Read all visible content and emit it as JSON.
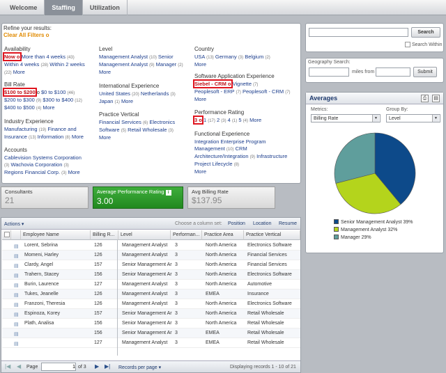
{
  "tabs": [
    "Welcome",
    "Staffing",
    "Utilization"
  ],
  "refine": {
    "title": "Refine your results:",
    "clear": "Clear All Filters",
    "clear_icon": "o"
  },
  "availability": {
    "title": "Availability",
    "now": "Now o",
    "line1": "More than 4 weeks",
    "c1": "(43)",
    "line2": "Within 4 weeks",
    "c2": "(28)",
    "line3": "Within 2 weeks",
    "c3": "(22)",
    "more": "More"
  },
  "billrate": {
    "title": "Bill Rate",
    "sel": "$100 to $200",
    "x": "o",
    "r1": "$0 to $100",
    "c1": "(46)",
    "r2": "$200 to $300",
    "c2": "(9)",
    "r3": "$300 to $400",
    "c3": "(12)",
    "r4": "$400 to $500",
    "c4": "(4)",
    "more": "More"
  },
  "industry": {
    "title": "Industry Experience",
    "i1": "Manufacturing",
    "c1": "(19)",
    "i2": "Finance and Insurance",
    "c2": "(13)",
    "i3": "Information",
    "c3": "(8)",
    "more": "More"
  },
  "accounts": {
    "title": "Accounts",
    "a1": "Cablevision Systems Corporation",
    "c1": "(3)",
    "a2": "Wachovia Corporation",
    "c2": "(3)",
    "a3": "Regions Financial Corp.",
    "c3": "(3)",
    "more": "More"
  },
  "level": {
    "title": "Level",
    "l1": "Management Analyst",
    "c1": "(10)",
    "l2": "Senior Management Analyst",
    "c2": "(9)",
    "l3": "Manager",
    "c3": "(2)",
    "more": "More"
  },
  "intl": {
    "title": "International Experience",
    "i1": "United States",
    "c1": "(20)",
    "i2": "Netherlands",
    "c2": "(3)",
    "i3": "Japan",
    "c3": "(1)",
    "more": "More"
  },
  "practice": {
    "title": "Practice Vertical",
    "p1": "Financial Services",
    "c1": "(6)",
    "p2": "Electronics Software",
    "c2": "(5)",
    "p3": "Retail Wholesale",
    "c3": "(3)",
    "more": "More"
  },
  "country": {
    "title": "Country",
    "k1": "USA",
    "c1": "(13)",
    "k2": "Germany",
    "c2": "(3)",
    "k3": "Belgium",
    "c3": "(2)",
    "more": "More"
  },
  "software": {
    "title": "Software Application Experience",
    "sel": "Siebel - CRM o",
    "s1": "Vignette",
    "c1": "(7)",
    "s2": "Peoplesoft - ERP",
    "c2": "(7)",
    "s3": "Peoplesoft - CRM",
    "c3": "(7)",
    "more": "More"
  },
  "perf": {
    "title": "Performance Rating",
    "sel": "3 o",
    "v1": "1",
    "c1": "(17)",
    "v2": "2",
    "c2": "(3)",
    "v3": "4",
    "c3": "(1)",
    "v4": "5",
    "c4": "(4)",
    "more": "More"
  },
  "functional": {
    "title": "Functional Experience",
    "f1": "Integration Enterprise Program Management",
    "c1": "(10)",
    "f2": "CRM Architecture/Integration",
    "c2": "(9)",
    "f3": "Infrastructure Project Lifecycle",
    "c3": "(8)",
    "more": "More"
  },
  "search": {
    "button": "Search",
    "within": "Search Within"
  },
  "geo": {
    "label": "Geography Search:",
    "from": "miles from",
    "submit": "Submit"
  },
  "kpis": [
    {
      "label": "Consultants",
      "value": "21"
    },
    {
      "label": "Average Performance Rating",
      "value": "3.00"
    },
    {
      "label": "Avg Billing Rate",
      "value": "$137.95"
    }
  ],
  "averages": {
    "title": "Averages",
    "metrics_label": "Metrics:",
    "metrics_value": "Billing Rate",
    "group_label": "Group By:",
    "group_value": "Level"
  },
  "chart_data": {
    "type": "pie",
    "title": "",
    "categories": [
      "Senior Management Analyst",
      "Management Analyst",
      "Manager"
    ],
    "values": [
      39,
      32,
      29
    ],
    "legend": [
      "Senior Management Analyst 39%",
      "Management Analyst 32%",
      "Manager 29%"
    ],
    "colors": [
      "#0d4a8a",
      "#b4d41c",
      "#5f9e9c"
    ]
  },
  "grid": {
    "actions": "Actions",
    "choose": "Choose a column set:",
    "sets": [
      "Position",
      "Location",
      "Resume"
    ],
    "headers": [
      "Employee Name",
      "Billing R...",
      "Level",
      "Performan...",
      "Practice Area",
      "Practice Vertical"
    ],
    "rows": [
      [
        "Lorent, Sebrina",
        "126",
        "Management Analyst",
        "3",
        "North America",
        "Electronics Software"
      ],
      [
        "Momeni, Harley",
        "126",
        "Management Analyst",
        "3",
        "North America",
        "Financial Services"
      ],
      [
        "Clardy, Angel",
        "157",
        "Senior Management Ar",
        "3",
        "North America",
        "Financial Services"
      ],
      [
        "Trahern, Stacey",
        "156",
        "Senior Management Ar",
        "3",
        "North America",
        "Electronics Software"
      ],
      [
        "Burin, Laurence",
        "127",
        "Management Analyst",
        "3",
        "North America",
        "Automotive"
      ],
      [
        "Tukes, Jeanelle",
        "126",
        "Management Analyst",
        "3",
        "EMEA",
        "Insurance"
      ],
      [
        "Franzoni, Theresia",
        "126",
        "Management Analyst",
        "3",
        "North America",
        "Electronics Software"
      ],
      [
        "Espinoza, Korey",
        "157",
        "Senior Management Ar",
        "3",
        "North America",
        "Retail Wholesale"
      ],
      [
        "Plath, Analisa",
        "156",
        "Senior Management Ar",
        "3",
        "North America",
        "Retail Wholesale"
      ],
      [
        "",
        "156",
        "Senior Management Ar",
        "3",
        "EMEA",
        "Retail Wholesale"
      ],
      [
        "",
        "127",
        "Management Analyst",
        "3",
        "EMEA",
        "Retail Wholesale"
      ]
    ],
    "page_label": "Page",
    "page_value": "1",
    "of": "of 3",
    "rpp": "Records per page",
    "display": "Displaying records 1 - 10 of 21"
  }
}
